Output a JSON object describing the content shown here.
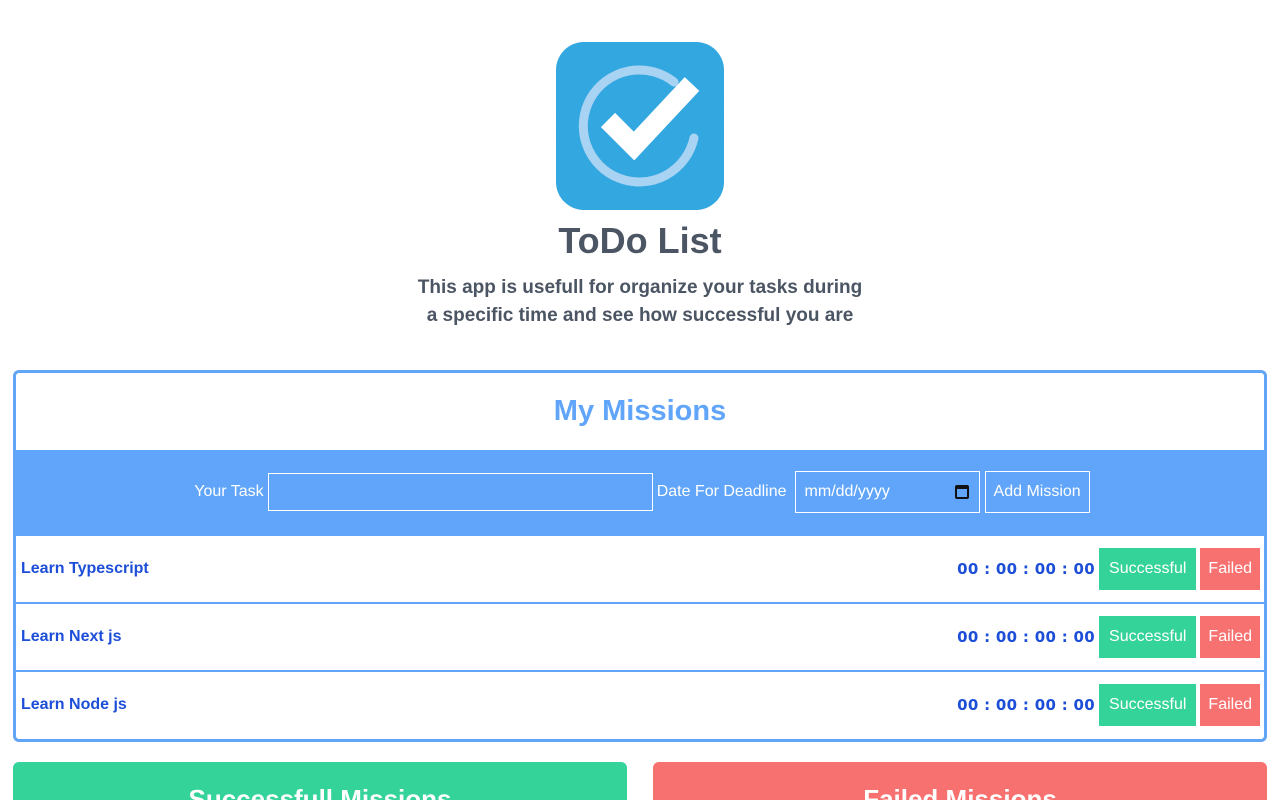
{
  "app": {
    "title": "ToDo List",
    "description": "This app is usefull for organize your tasks during a specific time and see how successful you are",
    "logo_icon": "check-circle-icon",
    "logo_color": "#33a7e0"
  },
  "missions": {
    "header": "My Missions",
    "form": {
      "task_label": "Your Task",
      "task_value": "",
      "deadline_label": "Date For Deadline",
      "deadline_placeholder": "mm/dd/yyyy",
      "add_button": "Add Mission"
    },
    "items": [
      {
        "name": "Learn Typescript",
        "countdown": "00 : 00 : 00 : 00",
        "success_label": "Successful",
        "failed_label": "Failed"
      },
      {
        "name": "Learn Next js",
        "countdown": "00 : 00 : 00 : 00",
        "success_label": "Successful",
        "failed_label": "Failed"
      },
      {
        "name": "Learn Node js",
        "countdown": "00 : 00 : 00 : 00",
        "success_label": "Successful",
        "failed_label": "Failed"
      }
    ]
  },
  "summary": {
    "successful_title": "Successfull Missions",
    "failed_title": "Failed Missions"
  },
  "colors": {
    "accent": "#60a5fa",
    "success": "#34d399",
    "failed": "#f87171",
    "text_dark": "#4b5563",
    "text_blue": "#1d4ed8"
  }
}
